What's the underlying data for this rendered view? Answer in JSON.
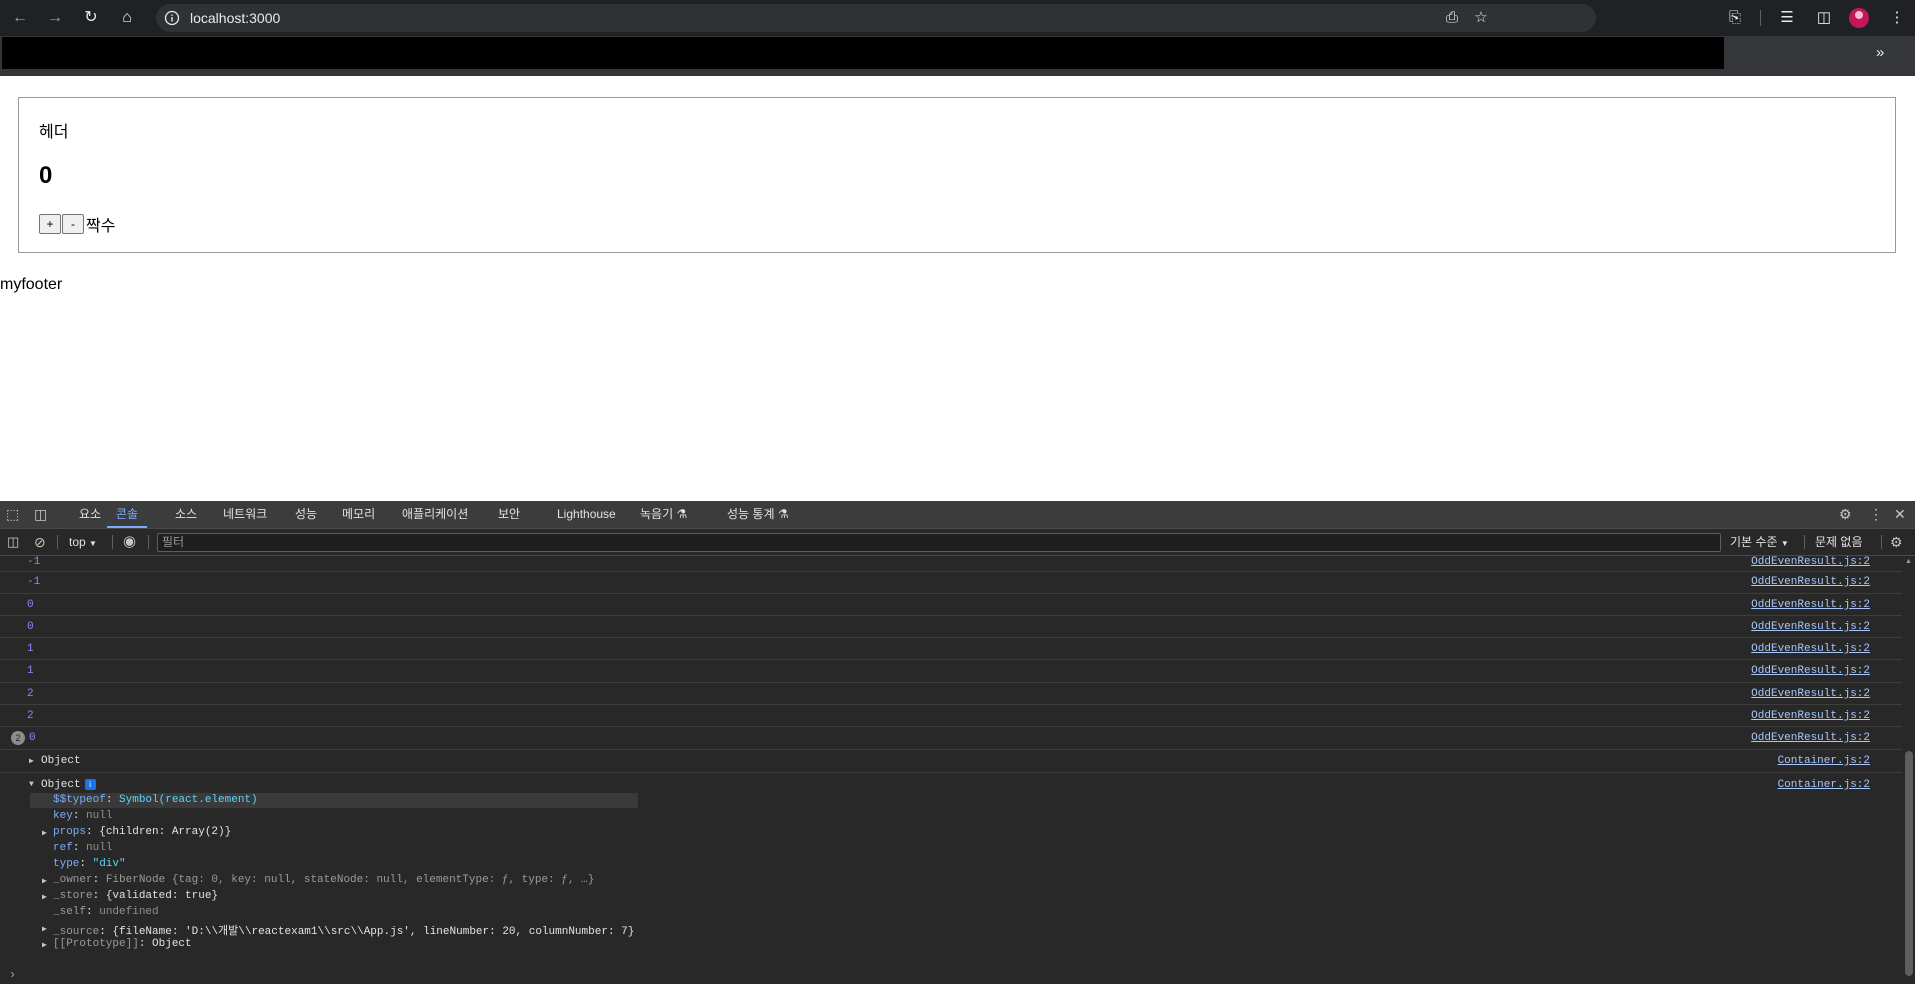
{
  "browser": {
    "url": "localhost:3000"
  },
  "page": {
    "header": "헤더",
    "count": "0",
    "plus_label": "+",
    "minus_label": "-",
    "parity": "짝수",
    "footer": "myfooter"
  },
  "devtools": {
    "tabs": [
      "요소",
      "콘솔",
      "소스",
      "네트워크",
      "성능",
      "메모리",
      "애플리케이션",
      "보안",
      "Lighthouse",
      "녹음기 ⚗",
      "성능 통계 ⚗"
    ],
    "active_tab": "콘솔",
    "context": "top",
    "filter_placeholder": "필터",
    "log_level": "기본 수준",
    "issues": "문제 없음",
    "logs": [
      {
        "value": "-1",
        "source": "OddEvenResult.js:2"
      },
      {
        "value": "-1",
        "source": "OddEvenResult.js:2"
      },
      {
        "value": "0",
        "source": "OddEvenResult.js:2"
      },
      {
        "value": "0",
        "source": "OddEvenResult.js:2"
      },
      {
        "value": "1",
        "source": "OddEvenResult.js:2"
      },
      {
        "value": "1",
        "source": "OddEvenResult.js:2"
      },
      {
        "value": "2",
        "source": "OddEvenResult.js:2"
      },
      {
        "value": "2",
        "source": "OddEvenResult.js:2"
      },
      {
        "value": "0",
        "source": "OddEvenResult.js:2",
        "repeat": "2"
      }
    ],
    "objects": [
      {
        "label": "Object",
        "source": "Container.js:2"
      },
      {
        "label": "Object",
        "source": "Container.js:2"
      }
    ],
    "object_props": {
      "typeof_key": "$$typeof",
      "typeof_val": "Symbol(react.element)",
      "key_key": "key",
      "key_val": "null",
      "props_key": "props",
      "props_val": "{children: Array(2)}",
      "ref_key": "ref",
      "ref_val": "null",
      "type_key": "type",
      "type_val": "\"div\"",
      "owner_key": "_owner",
      "owner_val": "FiberNode {tag: 0, key: null, stateNode: null, elementType: ƒ, type: ƒ, …}",
      "store_key": "_store",
      "store_val": "{validated: true}",
      "self_key": "_self",
      "self_val": "undefined",
      "source_key": "_source",
      "source_val": "{fileName: 'D:\\\\개발\\\\reactexam1\\\\src\\\\App.js', lineNumber: 20, columnNumber: 7}",
      "proto_key": "[[Prototype]]",
      "proto_val": "Object"
    },
    "prompt": "›"
  }
}
